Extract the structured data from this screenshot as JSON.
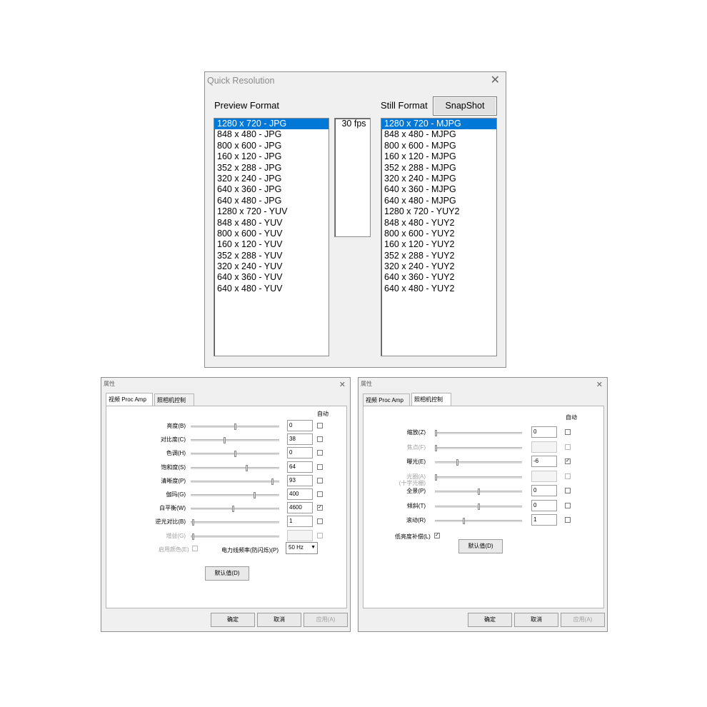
{
  "quick_resolution": {
    "title": "Quick Resolution",
    "preview_label": "Preview Format",
    "still_label": "Still Format",
    "snapshot_label": "SnapShot",
    "preview_items": [
      "1280 x  720 - JPG",
      "848 x 480 - JPG",
      "800 x 600 - JPG",
      "160 x 120 - JPG",
      "352 x 288 - JPG",
      "320 x 240 - JPG",
      "640 x 360 - JPG",
      "640 x 480 - JPG",
      "1280 x  720 - YUV",
      "848 x 480 - YUV",
      "800 x 600 - YUV",
      "160 x 120 - YUV",
      "352 x 288 - YUV",
      "320 x 240 - YUV",
      "640 x 360 - YUV",
      "640 x 480 - YUV"
    ],
    "preview_selected": 0,
    "fps_items": [
      "30 fps"
    ],
    "still_items": [
      "1280 x 720 - MJPG",
      "848 x 480 - MJPG",
      "800 x 600 - MJPG",
      "160 x 120 - MJPG",
      "352 x 288 - MJPG",
      "320 x 240 - MJPG",
      "640 x 360 - MJPG",
      "640 x 480 - MJPG",
      "1280 x 720 - YUY2",
      "848 x 480 - YUY2",
      "800 x 600 - YUY2",
      "160 x 120 - YUY2",
      "352 x 288 - YUY2",
      "320 x 240 - YUY2",
      "640 x 360 - YUY2",
      "640 x 480 - YUY2"
    ],
    "still_selected": 0
  },
  "prop_amp": {
    "title": "属性",
    "tabs": [
      "视频 Proc Amp",
      "照相机控制"
    ],
    "active_tab": 0,
    "auto_label": "自动",
    "rows": [
      {
        "label": "亮度(B)",
        "value": "0",
        "level": 0.5,
        "auto": false,
        "disabled": false
      },
      {
        "label": "对比度(C)",
        "value": "38",
        "level": 0.38,
        "auto": false,
        "disabled": false
      },
      {
        "label": "色调(H)",
        "value": "0",
        "level": 0.5,
        "auto": false,
        "disabled": false
      },
      {
        "label": "饱和度(S)",
        "value": "64",
        "level": 0.64,
        "auto": false,
        "disabled": false
      },
      {
        "label": "清晰度(P)",
        "value": "93",
        "level": 0.93,
        "auto": false,
        "disabled": false
      },
      {
        "label": "伽玛(G)",
        "value": "400",
        "level": 0.73,
        "auto": false,
        "disabled": false
      },
      {
        "label": "白平衡(W)",
        "value": "4600",
        "level": 0.48,
        "auto": true,
        "disabled": false
      },
      {
        "label": "逆光对比(B)",
        "value": "1",
        "level": 0.02,
        "auto": false,
        "disabled": false
      },
      {
        "label": "增益(G)",
        "value": "",
        "level": 0.02,
        "auto": false,
        "disabled": true
      }
    ],
    "color_enable_label": "启用颜色(E)",
    "power_freq_label": "电力线频率(防闪烁)(P)",
    "power_freq_value": "50 Hz",
    "default_label": "默认值(D)",
    "ok_label": "确定",
    "cancel_label": "取消",
    "apply_label": "应用(A)"
  },
  "camera_ctrl": {
    "title": "属性",
    "tabs": [
      "视频 Proc Amp",
      "照相机控制"
    ],
    "active_tab": 1,
    "auto_label": "自动",
    "rows": [
      {
        "label": "缩放(Z)",
        "value": "0",
        "level": 0.0,
        "auto": false,
        "disabled": false
      },
      {
        "label": "焦点(F)",
        "value": "",
        "level": 0.0,
        "auto": false,
        "disabled": true
      },
      {
        "label": "曝光(E)",
        "value": "-6",
        "level": 0.25,
        "auto": true,
        "disabled": false
      },
      {
        "label": "光圈(A)",
        "label2": "(十字光栅)",
        "value": "",
        "level": 0.0,
        "auto": false,
        "disabled": true
      },
      {
        "label": "全景(P)",
        "value": "0",
        "level": 0.5,
        "auto": false,
        "disabled": false
      },
      {
        "label": "倾斜(T)",
        "value": "0",
        "level": 0.5,
        "auto": false,
        "disabled": false
      },
      {
        "label": "滚动(R)",
        "value": "1",
        "level": 0.33,
        "auto": false,
        "disabled": false
      }
    ],
    "low_light_label": "低亮度补偿(L)",
    "low_light_checked": true,
    "default_label": "默认值(D)",
    "ok_label": "确定",
    "cancel_label": "取消",
    "apply_label": "应用(A)"
  }
}
